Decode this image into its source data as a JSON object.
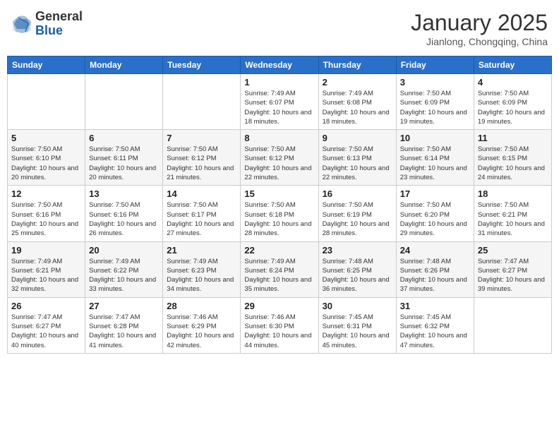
{
  "logo": {
    "general": "General",
    "blue": "Blue"
  },
  "header": {
    "title": "January 2025",
    "subtitle": "Jianlong, Chongqing, China"
  },
  "weekdays": [
    "Sunday",
    "Monday",
    "Tuesday",
    "Wednesday",
    "Thursday",
    "Friday",
    "Saturday"
  ],
  "weeks": [
    [
      {
        "day": "",
        "info": ""
      },
      {
        "day": "",
        "info": ""
      },
      {
        "day": "",
        "info": ""
      },
      {
        "day": "1",
        "info": "Sunrise: 7:49 AM\nSunset: 6:07 PM\nDaylight: 10 hours and 18 minutes."
      },
      {
        "day": "2",
        "info": "Sunrise: 7:49 AM\nSunset: 6:08 PM\nDaylight: 10 hours and 18 minutes."
      },
      {
        "day": "3",
        "info": "Sunrise: 7:50 AM\nSunset: 6:09 PM\nDaylight: 10 hours and 19 minutes."
      },
      {
        "day": "4",
        "info": "Sunrise: 7:50 AM\nSunset: 6:09 PM\nDaylight: 10 hours and 19 minutes."
      }
    ],
    [
      {
        "day": "5",
        "info": "Sunrise: 7:50 AM\nSunset: 6:10 PM\nDaylight: 10 hours and 20 minutes."
      },
      {
        "day": "6",
        "info": "Sunrise: 7:50 AM\nSunset: 6:11 PM\nDaylight: 10 hours and 20 minutes."
      },
      {
        "day": "7",
        "info": "Sunrise: 7:50 AM\nSunset: 6:12 PM\nDaylight: 10 hours and 21 minutes."
      },
      {
        "day": "8",
        "info": "Sunrise: 7:50 AM\nSunset: 6:12 PM\nDaylight: 10 hours and 22 minutes."
      },
      {
        "day": "9",
        "info": "Sunrise: 7:50 AM\nSunset: 6:13 PM\nDaylight: 10 hours and 22 minutes."
      },
      {
        "day": "10",
        "info": "Sunrise: 7:50 AM\nSunset: 6:14 PM\nDaylight: 10 hours and 23 minutes."
      },
      {
        "day": "11",
        "info": "Sunrise: 7:50 AM\nSunset: 6:15 PM\nDaylight: 10 hours and 24 minutes."
      }
    ],
    [
      {
        "day": "12",
        "info": "Sunrise: 7:50 AM\nSunset: 6:16 PM\nDaylight: 10 hours and 25 minutes."
      },
      {
        "day": "13",
        "info": "Sunrise: 7:50 AM\nSunset: 6:16 PM\nDaylight: 10 hours and 26 minutes."
      },
      {
        "day": "14",
        "info": "Sunrise: 7:50 AM\nSunset: 6:17 PM\nDaylight: 10 hours and 27 minutes."
      },
      {
        "day": "15",
        "info": "Sunrise: 7:50 AM\nSunset: 6:18 PM\nDaylight: 10 hours and 28 minutes."
      },
      {
        "day": "16",
        "info": "Sunrise: 7:50 AM\nSunset: 6:19 PM\nDaylight: 10 hours and 28 minutes."
      },
      {
        "day": "17",
        "info": "Sunrise: 7:50 AM\nSunset: 6:20 PM\nDaylight: 10 hours and 29 minutes."
      },
      {
        "day": "18",
        "info": "Sunrise: 7:50 AM\nSunset: 6:21 PM\nDaylight: 10 hours and 31 minutes."
      }
    ],
    [
      {
        "day": "19",
        "info": "Sunrise: 7:49 AM\nSunset: 6:21 PM\nDaylight: 10 hours and 32 minutes."
      },
      {
        "day": "20",
        "info": "Sunrise: 7:49 AM\nSunset: 6:22 PM\nDaylight: 10 hours and 33 minutes."
      },
      {
        "day": "21",
        "info": "Sunrise: 7:49 AM\nSunset: 6:23 PM\nDaylight: 10 hours and 34 minutes."
      },
      {
        "day": "22",
        "info": "Sunrise: 7:49 AM\nSunset: 6:24 PM\nDaylight: 10 hours and 35 minutes."
      },
      {
        "day": "23",
        "info": "Sunrise: 7:48 AM\nSunset: 6:25 PM\nDaylight: 10 hours and 36 minutes."
      },
      {
        "day": "24",
        "info": "Sunrise: 7:48 AM\nSunset: 6:26 PM\nDaylight: 10 hours and 37 minutes."
      },
      {
        "day": "25",
        "info": "Sunrise: 7:47 AM\nSunset: 6:27 PM\nDaylight: 10 hours and 39 minutes."
      }
    ],
    [
      {
        "day": "26",
        "info": "Sunrise: 7:47 AM\nSunset: 6:27 PM\nDaylight: 10 hours and 40 minutes."
      },
      {
        "day": "27",
        "info": "Sunrise: 7:47 AM\nSunset: 6:28 PM\nDaylight: 10 hours and 41 minutes."
      },
      {
        "day": "28",
        "info": "Sunrise: 7:46 AM\nSunset: 6:29 PM\nDaylight: 10 hours and 42 minutes."
      },
      {
        "day": "29",
        "info": "Sunrise: 7:46 AM\nSunset: 6:30 PM\nDaylight: 10 hours and 44 minutes."
      },
      {
        "day": "30",
        "info": "Sunrise: 7:45 AM\nSunset: 6:31 PM\nDaylight: 10 hours and 45 minutes."
      },
      {
        "day": "31",
        "info": "Sunrise: 7:45 AM\nSunset: 6:32 PM\nDaylight: 10 hours and 47 minutes."
      },
      {
        "day": "",
        "info": ""
      }
    ]
  ]
}
